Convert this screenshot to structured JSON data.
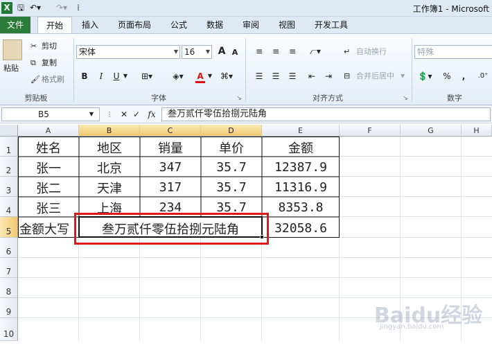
{
  "window": {
    "title": "工作簿1 - Microsoft"
  },
  "quick_access": {
    "save_icon": "save-icon",
    "undo_icon": "undo-icon",
    "redo_icon": "redo-icon"
  },
  "tabs": [
    {
      "label": "文件"
    },
    {
      "label": "开始"
    },
    {
      "label": "插入"
    },
    {
      "label": "页面布局"
    },
    {
      "label": "公式"
    },
    {
      "label": "数据"
    },
    {
      "label": "审阅"
    },
    {
      "label": "视图"
    },
    {
      "label": "开发工具"
    }
  ],
  "ribbon": {
    "clipboard": {
      "paste": "粘贴",
      "cut": "剪切",
      "copy": "复制",
      "format_painter": "格式刷",
      "group": "剪贴板"
    },
    "font": {
      "font_name": "宋体",
      "font_size": "16",
      "group": "字体",
      "bold": "B",
      "italic": "I",
      "underline": "U",
      "font_color_glyph": "A",
      "grow": "A",
      "shrink": "A"
    },
    "alignment": {
      "wrap": "自动换行",
      "merge": "合并后居中",
      "group": "对齐方式"
    },
    "number": {
      "format": "特殊",
      "group": "数字",
      "percent": "%",
      "comma": ","
    }
  },
  "formula_bar": {
    "name_box": "B5",
    "fx": "fx",
    "content": "叁万贰仟零伍拾捌元陆角"
  },
  "columns": [
    "A",
    "B",
    "C",
    "D",
    "E",
    "F",
    "G",
    "H"
  ],
  "rows": [
    "1",
    "2",
    "3",
    "4",
    "5",
    "6",
    "7",
    "8",
    "9",
    "10"
  ],
  "sheet": {
    "header": [
      "姓名",
      "地区",
      "销量",
      "单价",
      "金额"
    ],
    "data": [
      [
        "张一",
        "北京",
        "347",
        "35.7",
        "12387.9"
      ],
      [
        "张二",
        "天津",
        "317",
        "35.7",
        "11316.9"
      ],
      [
        "张三",
        "上海",
        "234",
        "35.7",
        "8353.8"
      ]
    ],
    "total_label": "金额大写",
    "total_words": "叁万贰仟零伍拾捌元陆角",
    "total_value": "32058.6"
  },
  "watermark": {
    "text": "Baidu经验",
    "url": "jingyan.baidu.com"
  }
}
